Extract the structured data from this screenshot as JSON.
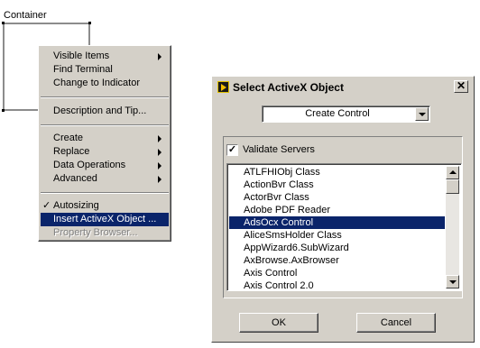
{
  "container": {
    "label": "Container"
  },
  "context_menu": {
    "items": [
      {
        "label": "Visible Items",
        "submenu": true
      },
      {
        "label": "Find Terminal"
      },
      {
        "label": "Change to Indicator"
      },
      {
        "label": "Description and Tip..."
      },
      {
        "label": "Create",
        "submenu": true
      },
      {
        "label": "Replace",
        "submenu": true
      },
      {
        "label": "Data Operations",
        "submenu": true
      },
      {
        "label": "Advanced",
        "submenu": true
      },
      {
        "label": "Autosizing",
        "checked": true,
        "check_mark": "✓"
      },
      {
        "label": "Insert ActiveX Object ...",
        "highlighted": true
      },
      {
        "label": "Property Browser...",
        "disabled": true
      }
    ]
  },
  "dialog": {
    "title": "Select ActiveX Object",
    "close_label": "✕",
    "combo_value": "Create Control",
    "validate_label": "Validate Servers",
    "validate_checked": true,
    "check_glyph": "✓",
    "list_items": [
      "ATLFHIObj Class",
      "ActionBvr Class",
      "ActorBvr Class",
      "Adobe PDF Reader",
      "AdsOcx Control",
      "AliceSmsHolder Class",
      "AppWizard6.SubWizard",
      "AxBrowse.AxBrowser",
      "Axis Control",
      "Axis Control 2.0"
    ],
    "selected_item": "AdsOcx Control",
    "ok_label": "OK",
    "cancel_label": "Cancel"
  },
  "colors": {
    "face": "#d4d0c8",
    "highlight": "#0a246a"
  }
}
